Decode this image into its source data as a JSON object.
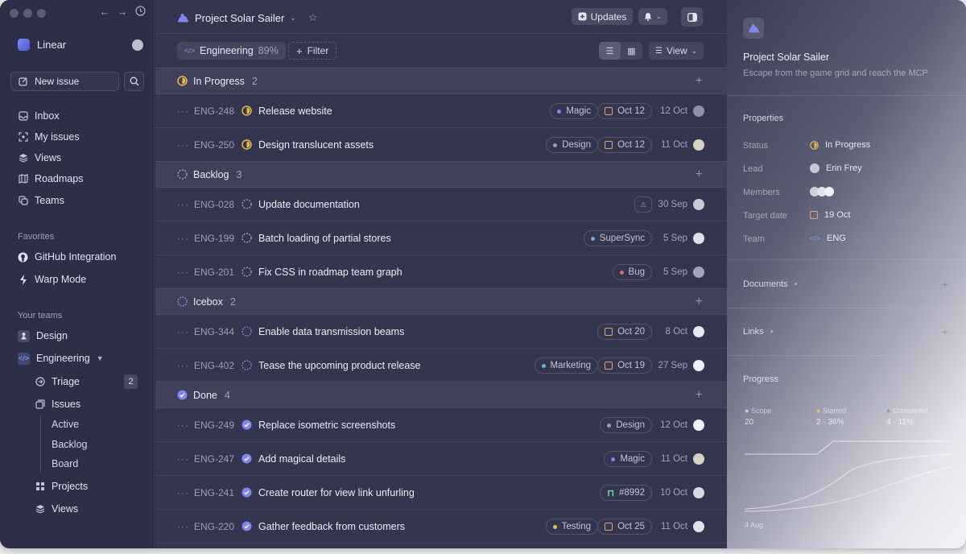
{
  "app": {
    "name": "Linear"
  },
  "sidebar": {
    "new_issue": "New issue",
    "nav": [
      {
        "label": "Inbox"
      },
      {
        "label": "My issues"
      },
      {
        "label": "Views"
      },
      {
        "label": "Roadmaps"
      },
      {
        "label": "Teams"
      }
    ],
    "favorites_label": "Favorites",
    "favorites": [
      {
        "label": "GitHub Integration"
      },
      {
        "label": "Warp Mode"
      }
    ],
    "teams_label": "Your teams",
    "teams": [
      {
        "label": "Design"
      },
      {
        "label": "Engineering"
      }
    ],
    "engineering_items": {
      "triage": "Triage",
      "triage_count": "2",
      "issues": "Issues",
      "issue_subs": [
        "Active",
        "Backlog",
        "Board"
      ],
      "projects": "Projects",
      "views": "Views"
    }
  },
  "header": {
    "project": "Project Solar Sailer",
    "updates": "Updates"
  },
  "filterbar": {
    "team": "Engineering",
    "team_pct": "89%",
    "filter": "Filter",
    "view": "View"
  },
  "groups": [
    {
      "name": "In Progress",
      "count": "2"
    },
    {
      "name": "Backlog",
      "count": "3"
    },
    {
      "name": "Icebox",
      "count": "2"
    },
    {
      "name": "Done",
      "count": "4"
    }
  ],
  "issues": [
    {
      "id": "ENG-248",
      "title": "Release website",
      "label": "Magic",
      "due": "Oct 12",
      "date": "12 Oct"
    },
    {
      "id": "ENG-250",
      "title": "Design translucent assets",
      "label": "Design",
      "due": "Oct 12",
      "date": "11 Oct"
    },
    {
      "id": "ENG-028",
      "title": "Update documentation",
      "date": "30 Sep"
    },
    {
      "id": "ENG-199",
      "title": "Batch loading of partial stores",
      "label": "SuperSync",
      "date": "5 Sep"
    },
    {
      "id": "ENG-201",
      "title": "Fix CSS in roadmap team graph",
      "label": "Bug",
      "date": "5 Sep"
    },
    {
      "id": "ENG-344",
      "title": "Enable data transmission beams",
      "due": "Oct 20",
      "date": "8 Oct"
    },
    {
      "id": "ENG-402",
      "title": "Tease the upcoming product release",
      "label": "Marketing",
      "due": "Oct 19",
      "date": "27 Sep"
    },
    {
      "id": "ENG-249",
      "title": "Replace isometric screenshots",
      "label": "Design",
      "date": "12 Oct"
    },
    {
      "id": "ENG-247",
      "title": "Add magical details",
      "label": "Magic",
      "date": "11 Oct"
    },
    {
      "id": "ENG-241",
      "title": "Create router for view link unfurling",
      "label": "#8992",
      "date": "10 Oct"
    },
    {
      "id": "ENG-220",
      "title": "Gather feedback from customers",
      "label": "Testing",
      "due": "Oct 25",
      "date": "11 Oct"
    }
  ],
  "panel": {
    "title": "Project Solar Sailer",
    "description": "Escape from the game grid and reach the MCP",
    "properties_label": "Properties",
    "properties": [
      {
        "key": "Status",
        "value": "In Progress"
      },
      {
        "key": "Lead",
        "value": "Erin Frey"
      },
      {
        "key": "Members",
        "value": ""
      },
      {
        "key": "Target date",
        "value": "19 Oct"
      },
      {
        "key": "Team",
        "value": "ENG"
      }
    ],
    "documents": "Documents",
    "links": "Links",
    "progress": "Progress",
    "legend": [
      {
        "name": "Scope",
        "value": "20"
      },
      {
        "name": "Started",
        "value": "2 · 36%"
      },
      {
        "name": "Completed",
        "value": "4 · 11%"
      }
    ],
    "chart_start": "4 Aug"
  },
  "colors": {
    "label_magic": "#7b86f0",
    "label_design": "#9a9bb0",
    "label_supersync": "#6fa6e6",
    "label_bug": "#e4667a",
    "label_marketing": "#5bb8d8",
    "label_testing": "#d7c455",
    "in_progress": "#e8b84a",
    "done": "#7d87ee"
  }
}
